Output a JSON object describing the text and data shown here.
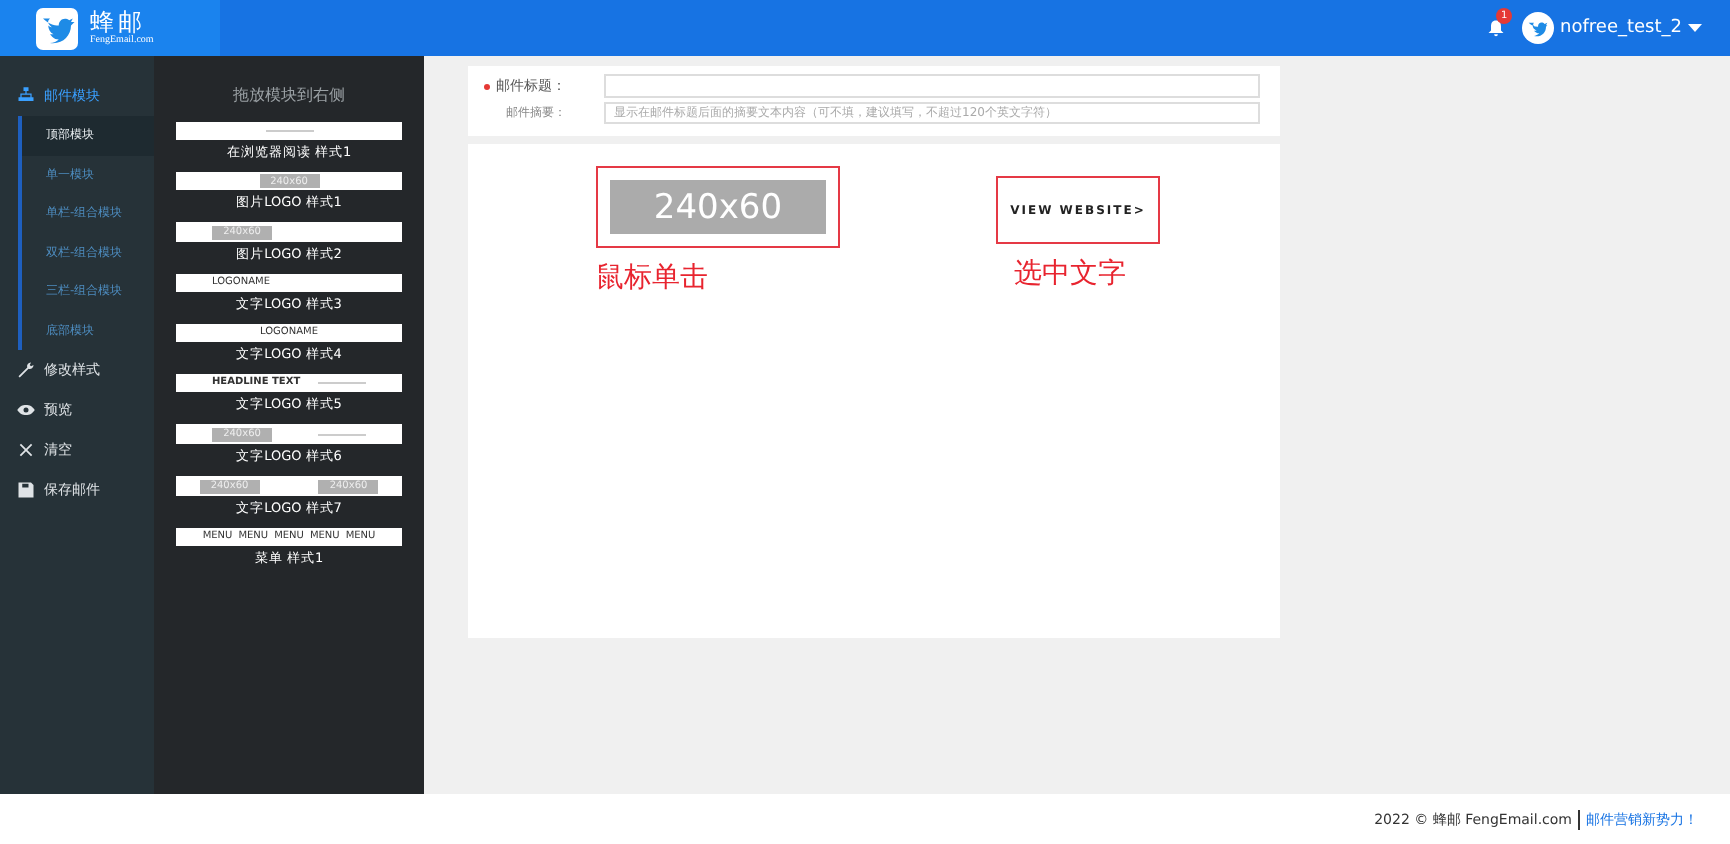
{
  "header": {
    "brand": "蜂邮",
    "domain": "FengEmail.com",
    "notifications": "1",
    "user": "nofree_test_2"
  },
  "sidebar": {
    "items": [
      {
        "label": "邮件模块",
        "expanded": true,
        "children": [
          {
            "label": "顶部模块",
            "selected": true
          },
          {
            "label": "单一模块",
            "selected": false
          },
          {
            "label": "单栏-组合模块",
            "selected": false
          },
          {
            "label": "双栏-组合模块",
            "selected": false
          },
          {
            "label": "三栏-组合模块",
            "selected": false
          },
          {
            "label": "底部模块",
            "selected": false
          }
        ]
      },
      {
        "label": "修改样式"
      },
      {
        "label": "预览"
      },
      {
        "label": "清空"
      },
      {
        "label": "保存邮件"
      }
    ]
  },
  "blocks": {
    "title": "拖放模块到右侧",
    "items": [
      {
        "kind": "bar",
        "label": "在浏览器阅读 样式1"
      },
      {
        "kind": "logo-center",
        "label": "图片LOGO 样式1",
        "texts": [
          "240x60"
        ]
      },
      {
        "kind": "logo-left",
        "label": "图片LOGO 样式2",
        "texts": [
          "240x60"
        ]
      },
      {
        "kind": "text-left",
        "label": "文字LOGO 样式3",
        "texts": [
          "LOGONAME"
        ]
      },
      {
        "kind": "text-center",
        "label": "文字LOGO 样式4",
        "texts": [
          "LOGONAME"
        ]
      },
      {
        "kind": "headline",
        "label": "文字LOGO 样式5",
        "texts": [
          "HEADLINE TEXT"
        ]
      },
      {
        "kind": "logo-link",
        "label": "文字LOGO 样式6",
        "texts": [
          "240x60"
        ]
      },
      {
        "kind": "two-logos",
        "label": "文字LOGO 样式7",
        "texts": [
          "240x60",
          "240x60"
        ]
      },
      {
        "kind": "menu",
        "label": "菜单 样式1",
        "texts": [
          "MENU",
          "MENU",
          "MENU",
          "MENU",
          "MENU"
        ]
      }
    ]
  },
  "form": {
    "fields": [
      {
        "label": "邮件标题：",
        "required": true
      },
      {
        "label": "邮件摘要：",
        "required": false,
        "placeholder": "显示在邮件标题后面的摘要文本内容（可不填，建议填写，不超过120个英文字符）"
      }
    ]
  },
  "canvas": {
    "logo": "240x60",
    "link": "VIEW WEBSITE>",
    "notes": [
      "鼠标单击",
      "选中文字"
    ]
  },
  "footer": {
    "copyright": "2022 © 蜂邮 FengEmail.com",
    "slogan": "邮件营销新势力！"
  }
}
